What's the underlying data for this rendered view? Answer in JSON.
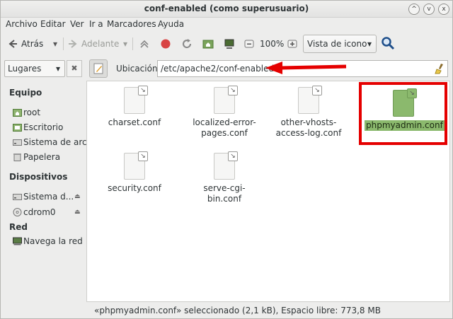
{
  "window": {
    "title": "conf-enabled (como superusuario)",
    "controls": [
      "^",
      "v",
      "x"
    ]
  },
  "menu": [
    "Archivo",
    "Editar",
    "Ver",
    "Ir a",
    "Marcadores",
    "Ayuda"
  ],
  "toolbar": {
    "back_label": "Atrás",
    "forward_label": "Adelante",
    "zoom_level": "100%",
    "view_mode": "Vista de icono"
  },
  "location": {
    "places_label": "Lugares",
    "label": "Ubicación:",
    "path": "/etc/apache2/conf-enabled"
  },
  "sidebar": {
    "sections": [
      {
        "title": "Equipo",
        "items": [
          "root",
          "Escritorio",
          "Sistema de arc...",
          "Papelera"
        ]
      },
      {
        "title": "Dispositivos",
        "items": [
          "Sistema d...",
          "cdrom0"
        ]
      },
      {
        "title": "Red",
        "items": [
          "Navega la red"
        ]
      }
    ]
  },
  "files": [
    {
      "name": "charset.conf",
      "selected": false
    },
    {
      "name": "localized-error-\npages.conf",
      "selected": false
    },
    {
      "name": "other-vhosts-\naccess-log.conf",
      "selected": false
    },
    {
      "name": "phpmyadmin.conf",
      "selected": true
    },
    {
      "name": "security.conf",
      "selected": false
    },
    {
      "name": "serve-cgi-bin.conf",
      "selected": false
    }
  ],
  "status": "«phpmyadmin.conf» seleccionado (2,1 kB), Espacio libre: 773,8 MB",
  "colors": {
    "selection": "#8bb96d",
    "annotation": "#e50000"
  }
}
